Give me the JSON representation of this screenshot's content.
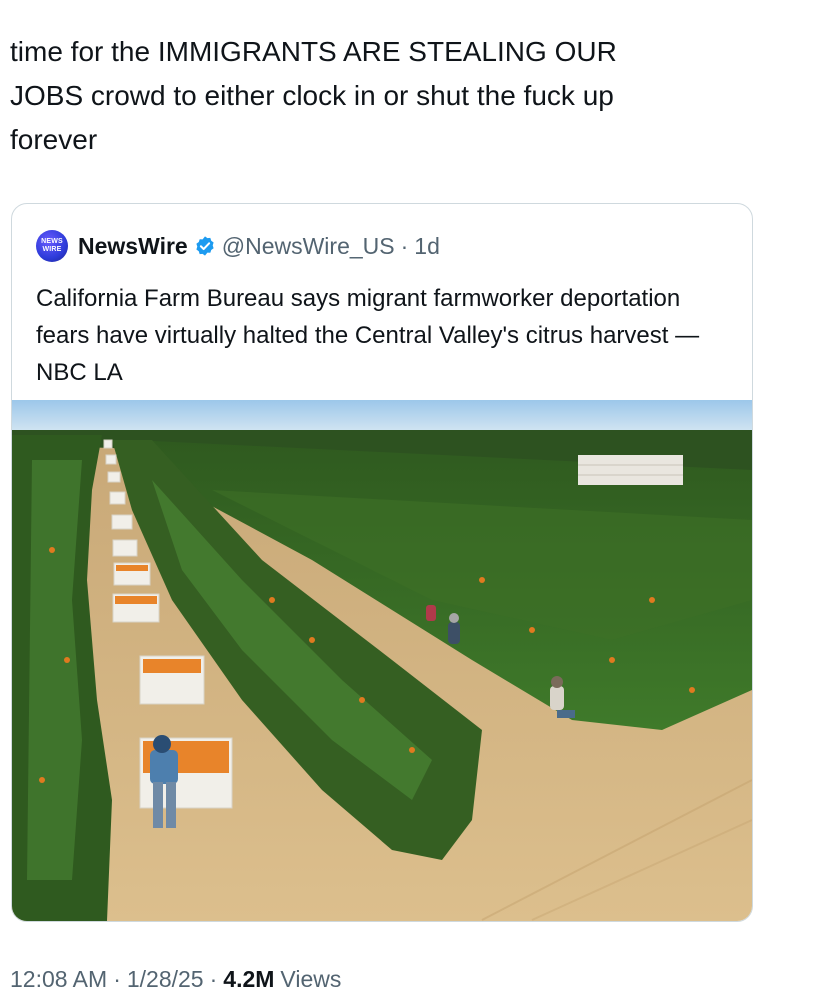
{
  "tweet": {
    "text": "time for the IMMIGRANTS ARE STEALING OUR\nJOBS crowd to either clock in or shut the fuck up\nforever"
  },
  "quoted_post": {
    "avatar_text": "NEWS WIRE",
    "author_name": "NewsWire",
    "verified_icon": "verified-badge-icon",
    "handle": "@NewsWire_US",
    "separator": "·",
    "time_ago": "1d",
    "text": "California Farm Bureau says migrant farmworker deportation fears have virtually halted the Central Valley's citrus harvest — NBC LA",
    "image_description_icon": "citrus-orchard-photo"
  },
  "meta": {
    "time": "12:08 AM",
    "sep1": "·",
    "date": "1/28/25",
    "sep2": "·",
    "views_count": "4.2M",
    "views_label": "Views"
  },
  "colors": {
    "text_primary": "#0f1419",
    "text_secondary": "#536471",
    "border": "#cfd9de",
    "verified": "#1d9bf0"
  }
}
